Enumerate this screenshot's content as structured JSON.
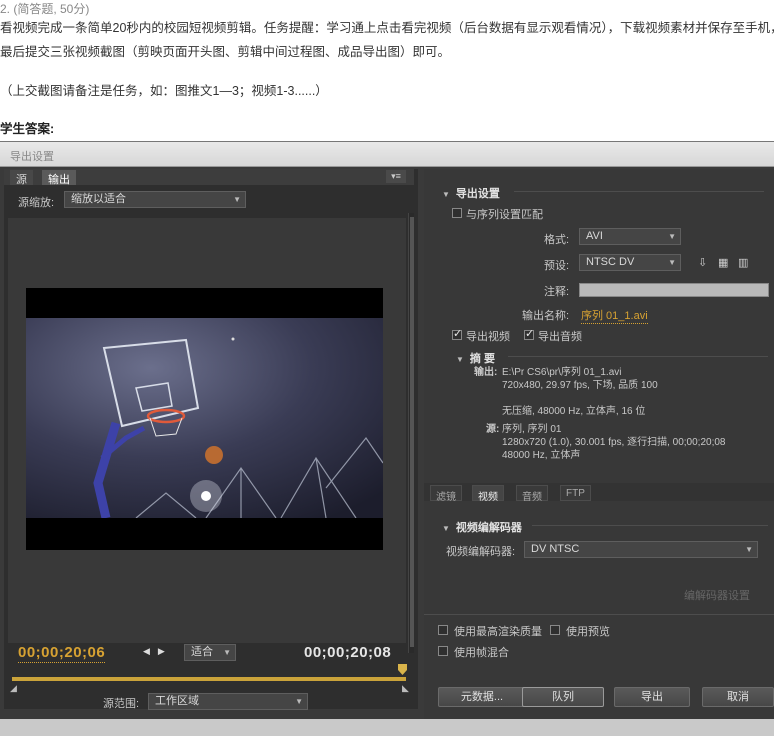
{
  "question": {
    "header": "2. (简答题, 50分)",
    "text": "看视频完成一条简单20秒内的校园短视频剪辑。任务提醒：学习通上点击看完视频（后台数据有显示观看情况），下载视频素材并保存至手机，最后提交三张视频截图（剪映页面开头图、剪辑中间过程图、成品导出图）即可。",
    "note": "（上交截图请备注是任务，如：图推文1—3；视频1-3......）",
    "answer_label": "学生答案:"
  },
  "dialog": {
    "title": "导出设置",
    "left": {
      "tabs": [
        "源",
        "输出"
      ],
      "panel_menu_icon": "panel-menu-icon",
      "source_zoom_label": "源缩放:",
      "source_zoom_value": "缩放以适合",
      "current_timecode": "00;00;20;06",
      "fit_value": "适合",
      "duration_timecode": "00;00;20;08",
      "source_range_label": "源范围:",
      "source_range_value": "工作区域",
      "timeline_progress": 0.98
    },
    "export_settings": {
      "section_title": "导出设置",
      "match_sequence_label": "与序列设置匹配",
      "match_sequence_checked": false,
      "format_label": "格式:",
      "format_value": "AVI",
      "preset_label": "预设:",
      "preset_value": "NTSC DV",
      "comment_label": "注释:",
      "comment_value": "",
      "output_name_label": "输出名称:",
      "output_name_value": "序列 01_1.avi",
      "export_video_label": "导出视频",
      "export_video_checked": true,
      "export_audio_label": "导出音频",
      "export_audio_checked": true
    },
    "summary": {
      "section_title": "摘 要",
      "output_label": "输出:",
      "output_lines": [
        "E:\\Pr CS6\\pr\\序列 01_1.avi",
        "720x480, 29.97 fps, 下场, 品质 100",
        "",
        "无压缩, 48000 Hz, 立体声, 16 位"
      ],
      "source_label": "源:",
      "source_lines": [
        "序列, 序列 01",
        "1280x720 (1.0), 30.001 fps, 逐行扫描, 00;00;20;08",
        "48000 Hz, 立体声"
      ]
    },
    "right_tabs": [
      "滤镜",
      "视频",
      "音频",
      "FTP"
    ],
    "active_right_tab": "视频",
    "video_codec": {
      "section_title": "视频编解码器",
      "codec_label": "视频编解码器:",
      "codec_value": "DV NTSC",
      "codec_settings_button": "编解码器设置"
    },
    "options": {
      "max_render_quality": "使用最高渲染质量",
      "use_previews": "使用预览",
      "frame_blending": "使用帧混合"
    },
    "buttons": {
      "metadata": "元数据...",
      "queue": "队列",
      "export": "导出",
      "cancel": "取消"
    }
  }
}
